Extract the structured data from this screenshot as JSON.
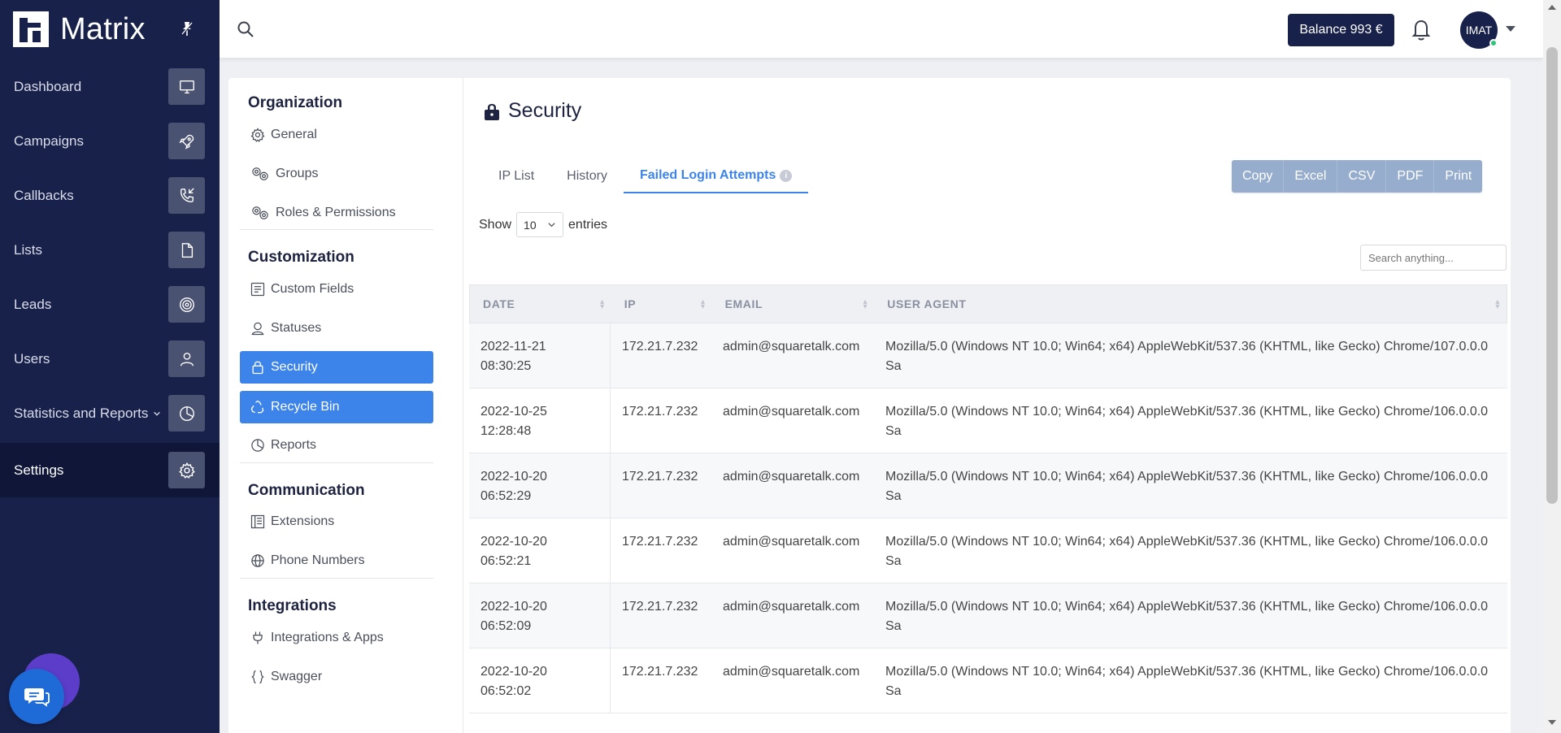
{
  "brand": {
    "name": "Matrix"
  },
  "sidebar": {
    "items": [
      {
        "label": "Dashboard",
        "icon": "monitor-icon"
      },
      {
        "label": "Campaigns",
        "icon": "rocket-icon"
      },
      {
        "label": "Callbacks",
        "icon": "phone-callback-icon"
      },
      {
        "label": "Lists",
        "icon": "document-icon"
      },
      {
        "label": "Leads",
        "icon": "target-icon"
      },
      {
        "label": "Users",
        "icon": "user-icon"
      },
      {
        "label": "Statistics and Reports",
        "icon": "pie-chart-icon"
      },
      {
        "label": "Settings",
        "icon": "gear-icon",
        "active": true
      }
    ]
  },
  "topbar": {
    "balance": "Balance 993 €",
    "avatar": "IMAT"
  },
  "settings_menu": {
    "sections": [
      {
        "title": "Organization",
        "items": [
          "General",
          "Groups",
          "Roles & Permissions"
        ]
      },
      {
        "title": "Customization",
        "items": [
          "Custom Fields",
          "Statuses",
          "Security",
          "Recycle Bin",
          "Reports"
        ]
      },
      {
        "title": "Communication",
        "items": [
          "Extensions",
          "Phone Numbers"
        ]
      },
      {
        "title": "Integrations",
        "items": [
          "Integrations & Apps",
          "Swagger"
        ]
      }
    ],
    "active_items": [
      "Security",
      "Recycle Bin"
    ]
  },
  "main": {
    "title": "Security",
    "tabs": [
      {
        "label": "IP List"
      },
      {
        "label": "History"
      },
      {
        "label": "Failed Login Attempts",
        "active": true,
        "info": "i"
      }
    ],
    "export_buttons": [
      "Copy",
      "Excel",
      "CSV",
      "PDF",
      "Print"
    ],
    "show_label": "Show",
    "entries_value": "10",
    "entries_label": "entries",
    "search_placeholder": "Search anything...",
    "table": {
      "columns": [
        "DATE",
        "IP",
        "EMAIL",
        "USER AGENT"
      ],
      "rows": [
        {
          "date": "2022-11-21",
          "time": "08:30:25",
          "ip": "172.21.7.232",
          "email": "admin@squaretalk.com",
          "ua": "Mozilla/5.0 (Windows NT 10.0; Win64; x64) AppleWebKit/537.36 (KHTML, like Gecko) Chrome/107.0.0.0 Sa"
        },
        {
          "date": "2022-10-25",
          "time": "12:28:48",
          "ip": "172.21.7.232",
          "email": "admin@squaretalk.com",
          "ua": "Mozilla/5.0 (Windows NT 10.0; Win64; x64) AppleWebKit/537.36 (KHTML, like Gecko) Chrome/106.0.0.0 Sa"
        },
        {
          "date": "2022-10-20",
          "time": "06:52:29",
          "ip": "172.21.7.232",
          "email": "admin@squaretalk.com",
          "ua": "Mozilla/5.0 (Windows NT 10.0; Win64; x64) AppleWebKit/537.36 (KHTML, like Gecko) Chrome/106.0.0.0 Sa"
        },
        {
          "date": "2022-10-20",
          "time": "06:52:21",
          "ip": "172.21.7.232",
          "email": "admin@squaretalk.com",
          "ua": "Mozilla/5.0 (Windows NT 10.0; Win64; x64) AppleWebKit/537.36 (KHTML, like Gecko) Chrome/106.0.0.0 Sa"
        },
        {
          "date": "2022-10-20",
          "time": "06:52:09",
          "ip": "172.21.7.232",
          "email": "admin@squaretalk.com",
          "ua": "Mozilla/5.0 (Windows NT 10.0; Win64; x64) AppleWebKit/537.36 (KHTML, like Gecko) Chrome/106.0.0.0 Sa"
        },
        {
          "date": "2022-10-20",
          "time": "06:52:02",
          "ip": "172.21.7.232",
          "email": "admin@squaretalk.com",
          "ua": "Mozilla/5.0 (Windows NT 10.0; Win64; x64) AppleWebKit/537.36 (KHTML, like Gecko) Chrome/106.0.0.0 Sa"
        }
      ]
    }
  },
  "colors": {
    "sidebar": "#18214a",
    "accent": "#3d84ea",
    "export": "#96adcd"
  }
}
